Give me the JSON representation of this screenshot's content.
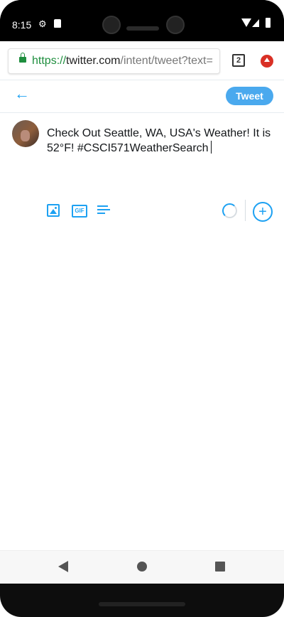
{
  "status_bar": {
    "time": "8:15"
  },
  "browser": {
    "url_scheme": "https://",
    "url_host": "twitter.com",
    "url_path": "/intent/tweet?text=",
    "tabs_count": "2"
  },
  "compose": {
    "tweet_button_label": "Tweet",
    "tweet_text": "Check Out Seattle, WA, USA's Weather! It is 52°F! #CSCI571WeatherSearch"
  },
  "icons": {
    "back": "arrow-left-icon",
    "media": "image-icon",
    "gif": "gif-icon",
    "gif_label": "GIF",
    "poll": "poll-icon",
    "progress": "character-count-icon",
    "add": "add-tweet-icon",
    "plus_glyph": "+"
  },
  "colors": {
    "accent": "#1da1f2",
    "tweet_button": "#4aa9ee",
    "secure_green": "#1e8e3e",
    "extension_red": "#d93025"
  }
}
